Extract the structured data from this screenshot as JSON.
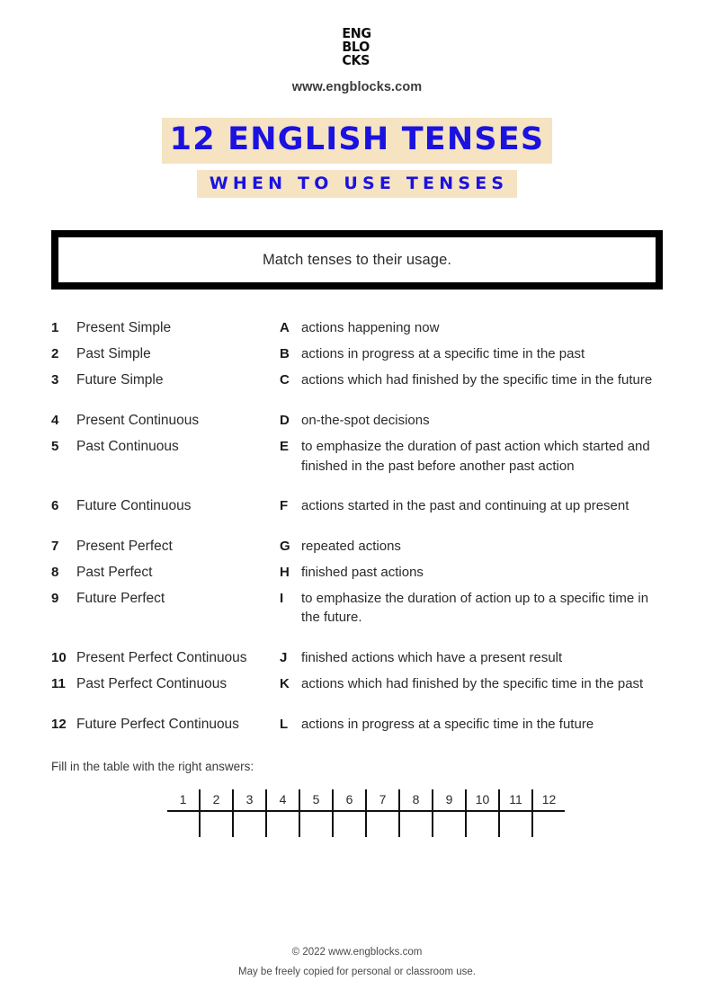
{
  "brand": {
    "logo_lines": [
      "ENG",
      "BLO",
      "CKS"
    ],
    "site_url": "www.engblocks.com"
  },
  "titles": {
    "main": "12 ENGLISH TENSES",
    "sub": "WHEN TO USE TENSES",
    "highlight_color": "#f5e3c2",
    "title_color": "#1b12e0"
  },
  "instruction": {
    "text": "Match tenses to their usage."
  },
  "matching": {
    "tenses": [
      {
        "num": "1",
        "label": "Present Simple"
      },
      {
        "num": "2",
        "label": "Past Simple"
      },
      {
        "num": "3",
        "label": "Future Simple"
      },
      {
        "num": "4",
        "label": "Present Continuous"
      },
      {
        "num": "5",
        "label": "Past Continuous"
      },
      {
        "num": "6",
        "label": "Future Continuous"
      },
      {
        "num": "7",
        "label": "Present Perfect"
      },
      {
        "num": "8",
        "label": "Past Perfect"
      },
      {
        "num": "9",
        "label": "Future Perfect"
      },
      {
        "num": "10",
        "label": "Present Perfect Continuous"
      },
      {
        "num": "11",
        "label": "Past Perfect Continuous"
      },
      {
        "num": "12",
        "label": "Future Perfect Continuous"
      }
    ],
    "usages": [
      {
        "letter": "A",
        "text": "actions happening now"
      },
      {
        "letter": "B",
        "text": "actions in progress at a specific time in the past"
      },
      {
        "letter": "C",
        "text": "actions which had finished by the specific time in the future"
      },
      {
        "letter": "D",
        "text": "on-the-spot decisions"
      },
      {
        "letter": "E",
        "text": "to emphasize the duration of past action which started and finished in the past before another past action"
      },
      {
        "letter": "F",
        "text": "actions started in the past and continuing at up present"
      },
      {
        "letter": "G",
        "text": "repeated actions"
      },
      {
        "letter": "H",
        "text": "finished past actions"
      },
      {
        "letter": "I",
        "text": "to emphasize the duration of action up to a specific time in the future."
      },
      {
        "letter": "J",
        "text": "finished actions which have a present result"
      },
      {
        "letter": "K",
        "text": "actions which had finished by the specific time in the past"
      },
      {
        "letter": "L",
        "text": "actions in progress at a specific time in the future"
      }
    ]
  },
  "answer_table": {
    "label": "Fill in the table with the right answers:",
    "headers": [
      "1",
      "2",
      "3",
      "4",
      "5",
      "6",
      "7",
      "8",
      "9",
      "10",
      "11",
      "12"
    ],
    "answers": [
      "",
      "",
      "",
      "",
      "",
      "",
      "",
      "",
      "",
      "",
      "",
      ""
    ]
  },
  "footer": {
    "copyright": "© 2022 www.engblocks.com",
    "notice": "May be freely copied for personal or classroom use."
  }
}
